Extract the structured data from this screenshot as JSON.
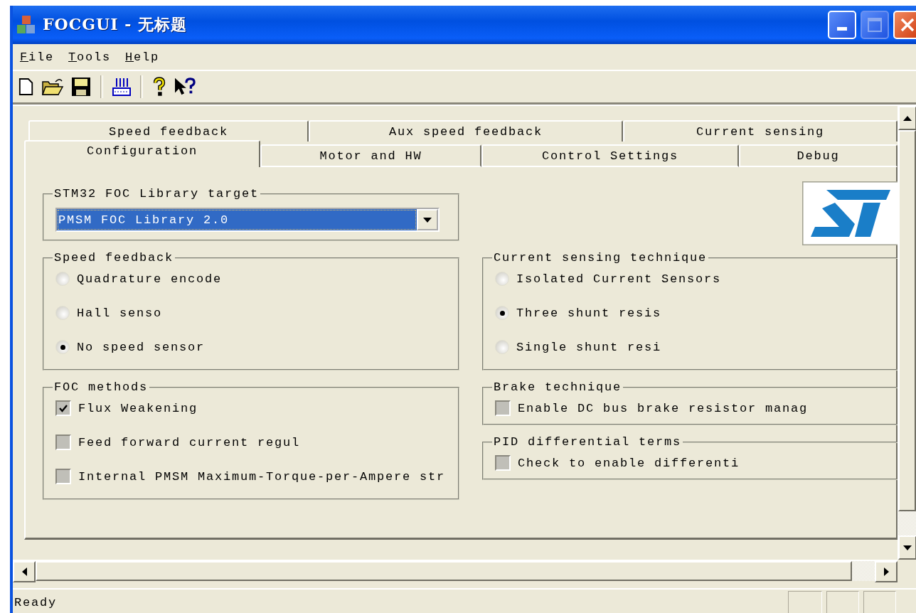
{
  "window": {
    "title": "FOCGUI - 无标题"
  },
  "menu": [
    {
      "label": "File"
    },
    {
      "label": "Tools"
    },
    {
      "label": "Help"
    }
  ],
  "toolbar": [
    {
      "kind": "new"
    },
    {
      "kind": "open"
    },
    {
      "kind": "save"
    },
    {
      "kind": "separator"
    },
    {
      "kind": "tool"
    },
    {
      "kind": "separator"
    },
    {
      "kind": "help"
    },
    {
      "kind": "context-help"
    }
  ],
  "tabs": {
    "back_row": [
      {
        "label": "Speed feedback",
        "selected": false
      },
      {
        "label": "Aux speed feedback",
        "selected": false
      },
      {
        "label": "Current sensing",
        "selected": false
      }
    ],
    "front_row": [
      {
        "label": "Configuration",
        "selected": true
      },
      {
        "label": "Motor and HW",
        "selected": false
      },
      {
        "label": "Control Settings",
        "selected": false
      },
      {
        "label": "Debug",
        "selected": false
      }
    ]
  },
  "target_group": {
    "title": "STM32 FOC Library target",
    "value": "PMSM FOC Library 2.0"
  },
  "left_groups": [
    {
      "title": "Speed feedback",
      "options": [
        {
          "kind": "radio",
          "label": "Quadrature encode",
          "selected": false
        },
        {
          "kind": "radio",
          "label": "Hall senso",
          "selected": false
        },
        {
          "kind": "radio",
          "label": "No speed sensor",
          "selected": true
        }
      ]
    },
    {
      "title": "FOC methods",
      "options": [
        {
          "kind": "checkbox",
          "label": "Flux Weakening",
          "checked": true
        },
        {
          "kind": "checkbox",
          "label": "Feed forward current regul",
          "checked": false
        },
        {
          "kind": "checkbox",
          "label": "Internal PMSM Maximum-Torque-per-Ampere str",
          "checked": false
        }
      ]
    }
  ],
  "right_groups": [
    {
      "title": "Current sensing technique",
      "options": [
        {
          "kind": "radio",
          "label": "Isolated Current Sensors",
          "selected": false
        },
        {
          "kind": "radio",
          "label": "Three shunt resis",
          "selected": true
        },
        {
          "kind": "radio",
          "label": "Single shunt resi",
          "selected": false
        }
      ]
    },
    {
      "title": "Brake technique",
      "options": [
        {
          "kind": "checkbox",
          "label": "Enable DC bus brake resistor manag",
          "checked": false
        }
      ]
    },
    {
      "title": "PID differential terms",
      "options": [
        {
          "kind": "checkbox",
          "label": "Check to enable differenti",
          "checked": false
        }
      ]
    }
  ],
  "status_bar": {
    "text": "Ready"
  }
}
